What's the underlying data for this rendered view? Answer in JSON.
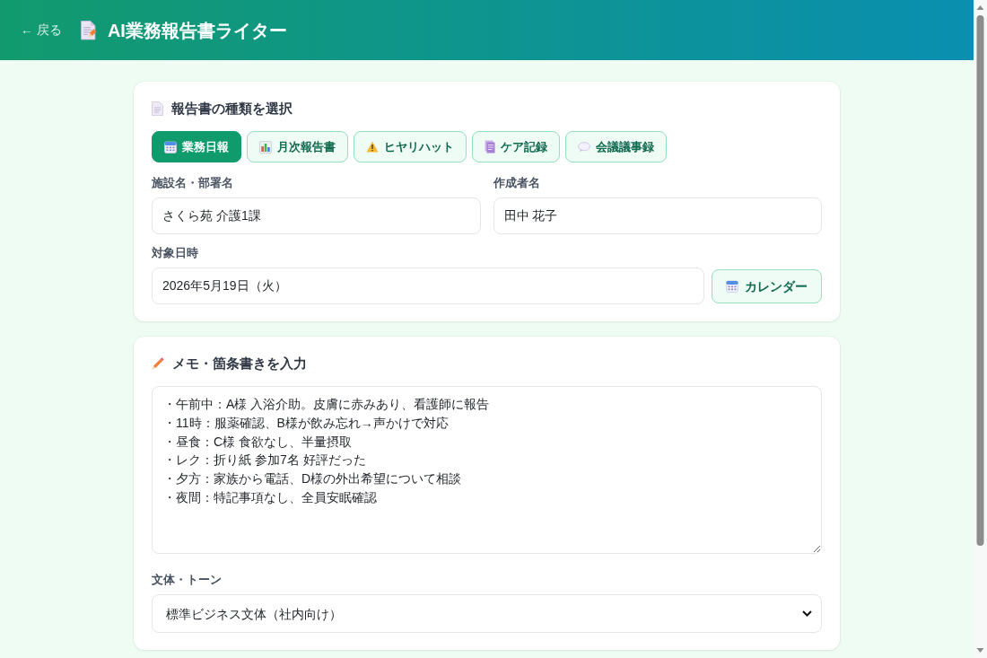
{
  "header": {
    "back_link": "← 戻る",
    "title": "AI業務報告書ライター"
  },
  "report_type": {
    "heading": "報告書の種類を選択",
    "tabs": [
      {
        "label": "業務日報",
        "selected": true
      },
      {
        "label": "月次報告書",
        "selected": false
      },
      {
        "label": "ヒヤリハット",
        "selected": false
      },
      {
        "label": "ケア記録",
        "selected": false
      },
      {
        "label": "会議議事録",
        "selected": false
      }
    ],
    "fields": [
      {
        "label": "施設名・部署名",
        "value": "さくら苑 介護1課"
      },
      {
        "label": "作成者名",
        "value": "田中 花子"
      }
    ],
    "date": {
      "label": "対象日時",
      "value": "2026年5月19日（火）",
      "button": "カレンダー"
    }
  },
  "memo": {
    "heading": "メモ・箇条書きを入力",
    "lines": [
      "・午前中：A様 入浴介助。皮膚に赤みあり、看護師に報告",
      "・11時：服薬確認、B様が飲み忘れ→声かけで対応",
      "・昼食：C様 食欲なし、半量摂取",
      "・レク：折り紙 参加7名 好評だった",
      "・夕方：家族から電話、D様の外出希望について相談",
      "・夜間：特記事項なし、全員安眠確認"
    ],
    "tone": {
      "label": "文体・トーン",
      "value": "標準ビジネス文体（社内向け）"
    }
  }
}
